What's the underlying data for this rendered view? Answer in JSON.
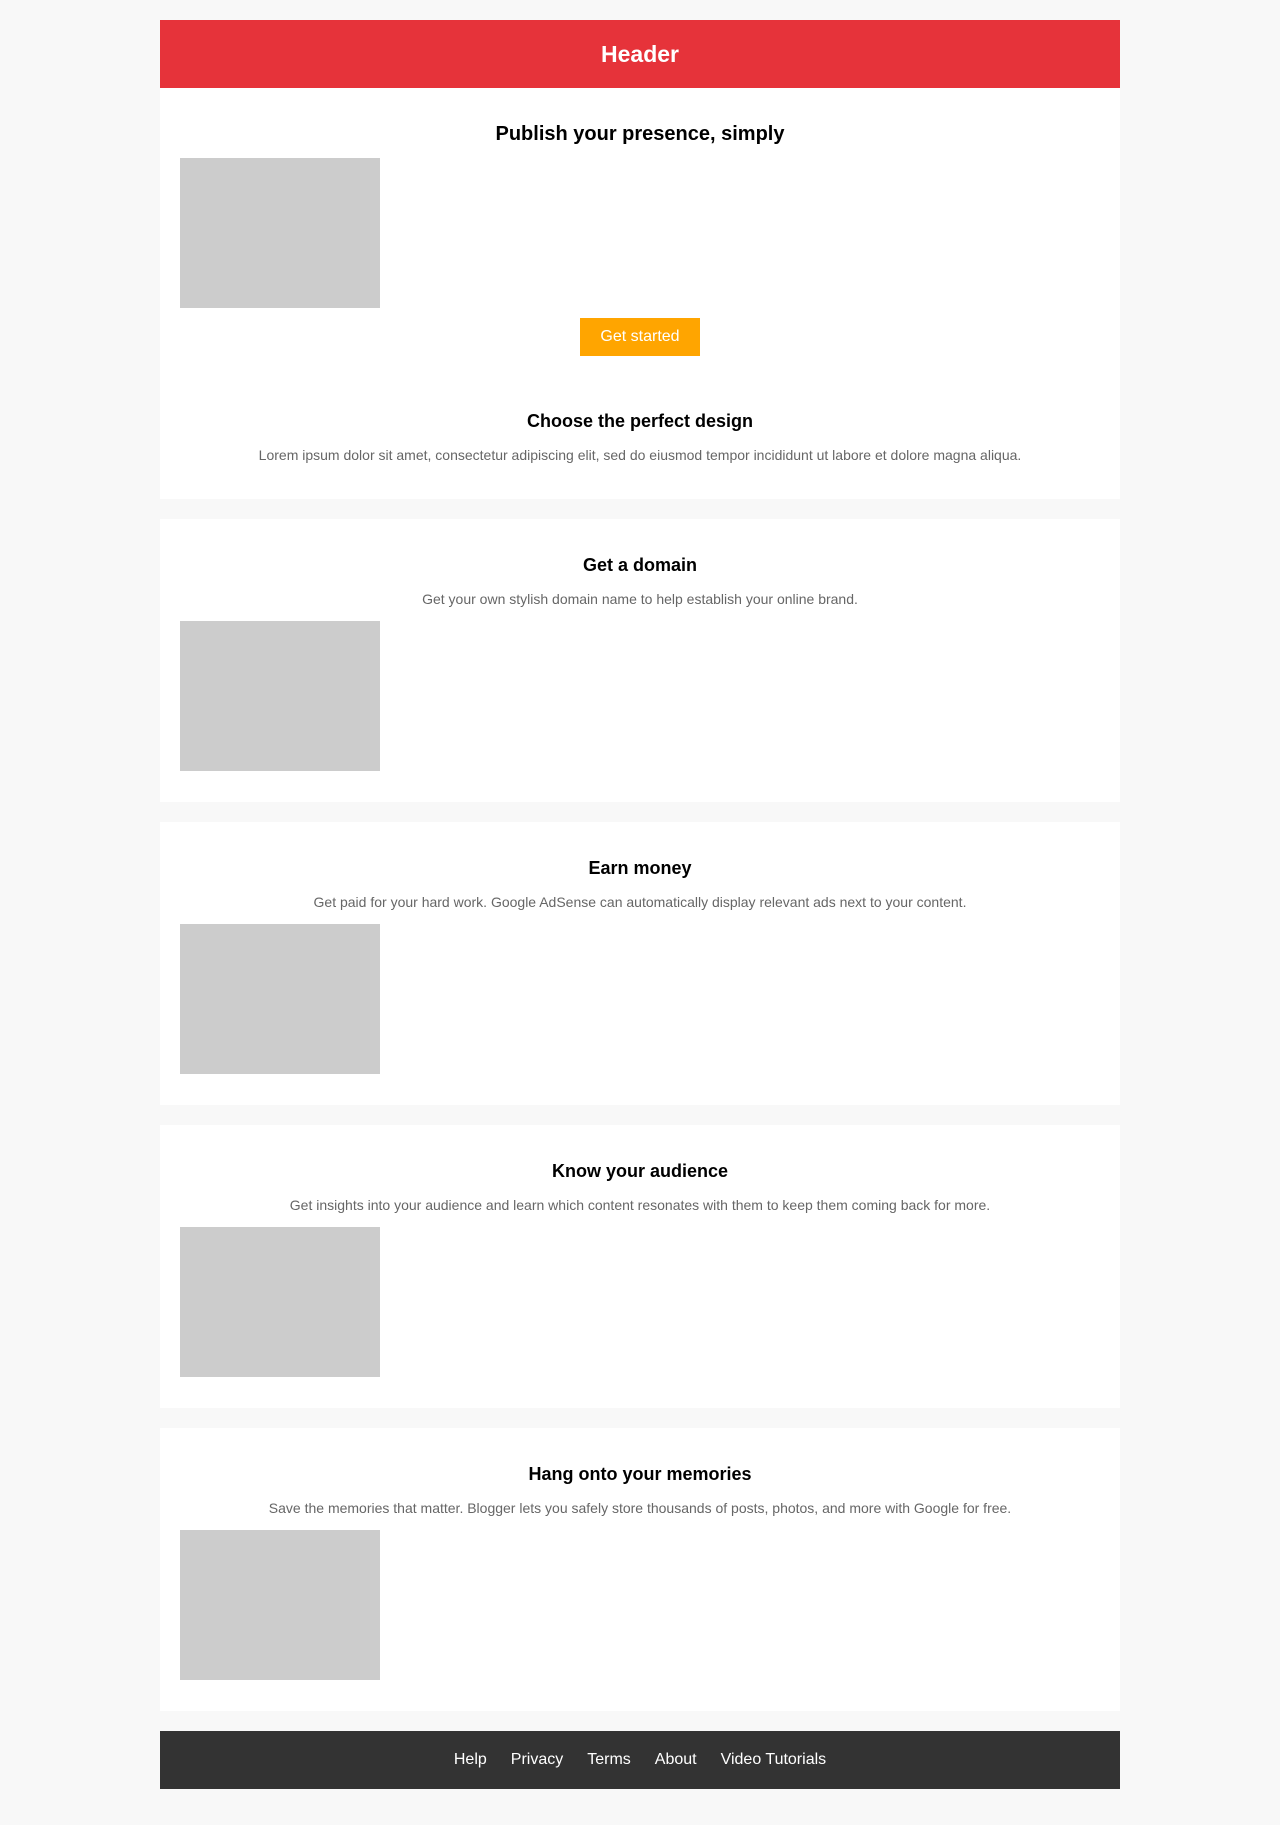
{
  "header": {
    "title": "Header"
  },
  "hero": {
    "title": "Publish your presence, simply",
    "cta_label": "Get started",
    "design_title": "Choose the perfect design",
    "design_description": "Lorem ipsum dolor sit amet, consectetur adipiscing elit, sed do eiusmod tempor incididunt ut labore et dolore magna aliqua."
  },
  "features": [
    {
      "title": "Get a domain",
      "description": "Get your own stylish domain name to help establish your online brand."
    },
    {
      "title": "Earn money",
      "description": "Get paid for your hard work. Google AdSense can automatically display relevant ads next to your content."
    },
    {
      "title": "Know your audience",
      "description": "Get insights into your audience and learn which content resonates with them to keep them coming back for more."
    },
    {
      "title": "Hang onto your memories",
      "description": "Save the memories that matter. Blogger lets you safely store thousands of posts, photos, and more with Google for free."
    }
  ],
  "footer": {
    "links": [
      "Help",
      "Privacy",
      "Terms",
      "About",
      "Video Tutorials"
    ]
  },
  "colors": {
    "header_bg": "#e6333a",
    "cta_bg": "#ffa500",
    "footer_bg": "#333333",
    "placeholder": "#cccccc",
    "page_bg": "#f8f8f8"
  }
}
